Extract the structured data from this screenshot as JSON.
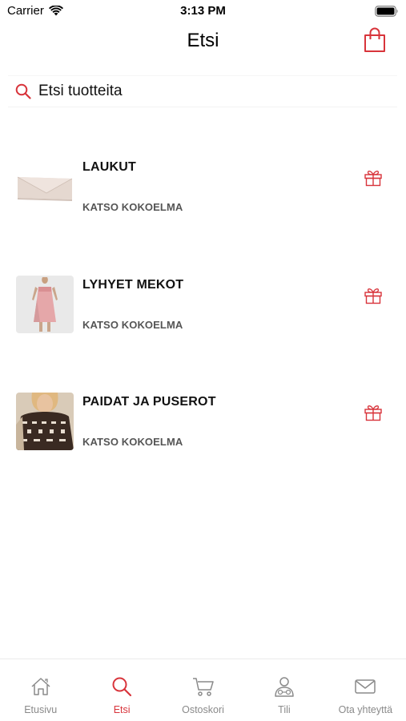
{
  "status_bar": {
    "carrier": "Carrier",
    "time": "3:13 PM"
  },
  "header": {
    "title": "Etsi",
    "cart_icon": "shopping-bag-icon"
  },
  "search": {
    "placeholder": "Etsi tuotteita",
    "icon": "search-icon"
  },
  "categories": [
    {
      "name": "LAUKUT",
      "subtitle": "KATSO KOKOELMA",
      "thumbnail": "clutch-bag-image",
      "icon": "gift-icon"
    },
    {
      "name": "LYHYET MEKOT",
      "subtitle": "KATSO KOKOELMA",
      "thumbnail": "pink-dress-image",
      "icon": "gift-icon"
    },
    {
      "name": "PAIDAT JA PUSEROT",
      "subtitle": "KATSO KOKOELMA",
      "thumbnail": "sweater-image",
      "icon": "gift-icon"
    }
  ],
  "tab_bar": {
    "active_index": 1,
    "tabs": [
      {
        "label": "Etusivu",
        "icon": "home-icon"
      },
      {
        "label": "Etsi",
        "icon": "search-icon"
      },
      {
        "label": "Ostoskori",
        "icon": "cart-icon"
      },
      {
        "label": "Tili",
        "icon": "account-icon"
      },
      {
        "label": "Ota yhteyttä",
        "icon": "mail-icon"
      }
    ]
  },
  "colors": {
    "accent": "#d8343b",
    "tab_inactive": "#8a8a8a",
    "subtitle": "#555555"
  }
}
